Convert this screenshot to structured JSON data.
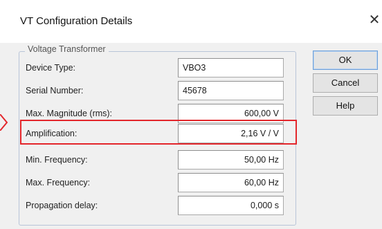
{
  "dialog": {
    "title": "VT Configuration Details",
    "close_glyph": "✕"
  },
  "group": {
    "title": "Voltage Transformer"
  },
  "fields": [
    {
      "label": "Device Type:",
      "value": "VBO3"
    },
    {
      "label": "Serial Number:",
      "value": "45678"
    },
    {
      "label": "Max. Magnitude (rms):",
      "value": "600,00 V"
    },
    {
      "label": "Amplification:",
      "value": "2,16 V / V"
    },
    {
      "label": "Min. Frequency:",
      "value": "50,00 Hz"
    },
    {
      "label": "Max. Frequency:",
      "value": "60,00 Hz"
    },
    {
      "label": "Propagation delay:",
      "value": "0,000 s"
    }
  ],
  "buttons": {
    "ok": "OK",
    "cancel": "Cancel",
    "help": "Help"
  },
  "colors": {
    "highlight": "#e3262b",
    "group_border": "#b8c4d8"
  }
}
